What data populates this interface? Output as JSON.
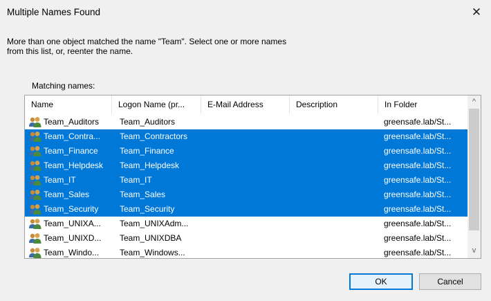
{
  "dialog": {
    "title": "Multiple Names Found",
    "close_glyph": "✕",
    "message": "More than one object matched the name \"Team\". Select one or more names\nfrom this list, or, reenter the name.",
    "matching_label": "Matching names:"
  },
  "list": {
    "columns": [
      "Name",
      "Logon Name (pr...",
      "E-Mail Address",
      "Description",
      "In Folder"
    ],
    "row_icon": "group-icon",
    "rows": [
      {
        "name": "Team_Auditors",
        "logon": "Team_Auditors",
        "email": "",
        "description": "",
        "folder": "greensafe.lab/St...",
        "selected": false
      },
      {
        "name": "Team_Contra...",
        "logon": "Team_Contractors",
        "email": "",
        "description": "",
        "folder": "greensafe.lab/St...",
        "selected": true
      },
      {
        "name": "Team_Finance",
        "logon": "Team_Finance",
        "email": "",
        "description": "",
        "folder": "greensafe.lab/St...",
        "selected": true
      },
      {
        "name": "Team_Helpdesk",
        "logon": "Team_Helpdesk",
        "email": "",
        "description": "",
        "folder": "greensafe.lab/St...",
        "selected": true
      },
      {
        "name": "Team_IT",
        "logon": "Team_IT",
        "email": "",
        "description": "",
        "folder": "greensafe.lab/St...",
        "selected": true
      },
      {
        "name": "Team_Sales",
        "logon": "Team_Sales",
        "email": "",
        "description": "",
        "folder": "greensafe.lab/St...",
        "selected": true
      },
      {
        "name": "Team_Security",
        "logon": "Team_Security",
        "email": "",
        "description": "",
        "folder": "greensafe.lab/St...",
        "selected": true
      },
      {
        "name": "Team_UNIXA...",
        "logon": "Team_UNIXAdm...",
        "email": "",
        "description": "",
        "folder": "greensafe.lab/St...",
        "selected": false
      },
      {
        "name": "Team_UNIXD...",
        "logon": "Team_UNIXDBA",
        "email": "",
        "description": "",
        "folder": "greensafe.lab/St...",
        "selected": false
      },
      {
        "name": "Team_Windo...",
        "logon": "Team_Windows...",
        "email": "",
        "description": "",
        "folder": "greensafe.lab/St...",
        "selected": false
      }
    ],
    "scroll_up_glyph": "^",
    "scroll_down_glyph": "v"
  },
  "buttons": {
    "ok": "OK",
    "cancel": "Cancel"
  },
  "colors": {
    "selection": "#0078d7",
    "dialog_bg": "#f0f0f0"
  }
}
